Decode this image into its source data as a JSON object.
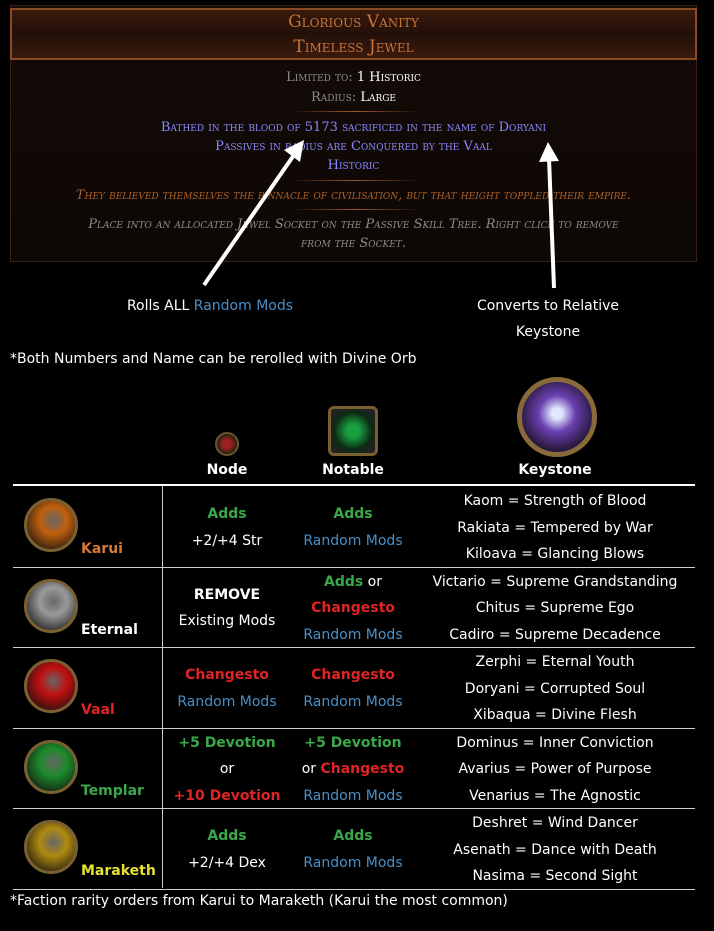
{
  "jewel": {
    "name": "Glorious Vanity",
    "base": "Timeless Jewel",
    "limited_label": "Limited to:",
    "limited_value": "1 Historic",
    "radius_label": "Radius:",
    "radius_value": "Large",
    "mods": [
      "Bathed in the blood of 5173 sacrificed in the name of Doryani",
      "Passives in radius are Conquered by the Vaal",
      "Historic"
    ],
    "flavor": "They believed themselves the pinnacle of civilisation, but that height toppled their empire.",
    "help": [
      "Place into an allocated Jewel Socket on the Passive Skill Tree. Right click to remove",
      "from the Socket."
    ]
  },
  "annotations": {
    "left_prefix": "Rolls ALL ",
    "left_highlight": "Random Mods",
    "right_line1": "Converts to Relative",
    "right_line2": "Keystone",
    "reroll_note": "*Both Numbers and Name can be rerolled with Divine Orb"
  },
  "columns": {
    "node": "Node",
    "notable": "Notable",
    "keystone": "Keystone"
  },
  "rows": [
    {
      "faction": "Karui",
      "faction_color": "#d27a3a",
      "orb_color": "#c0600e",
      "node": [
        [
          {
            "t": "Adds",
            "c": "green"
          }
        ],
        [
          {
            "t": "+2/+4 Str",
            "c": "white"
          }
        ]
      ],
      "notable": [
        [
          {
            "t": "Adds",
            "c": "green"
          }
        ],
        [
          {
            "t": "Random Mods",
            "c": "blue"
          }
        ]
      ],
      "keystones": [
        "Kaom = Strength of Blood",
        "Rakiata = Tempered by War",
        "Kiloava = Glancing Blows"
      ]
    },
    {
      "faction": "Eternal",
      "faction_color": "#ffffff",
      "orb_color": "#9a9a9a",
      "node": [
        [
          {
            "t": "REMOVE",
            "c": "whiteb"
          }
        ],
        [
          {
            "t": "Existing Mods",
            "c": "white"
          }
        ]
      ],
      "notable": [
        [
          {
            "t": "Adds",
            "c": "green"
          },
          {
            "t": " or",
            "c": "white"
          }
        ],
        [
          {
            "t": "Changesto",
            "c": "red"
          }
        ],
        [
          {
            "t": "Random Mods",
            "c": "blue"
          }
        ]
      ],
      "keystones": [
        "Victario = Supreme Grandstanding",
        "Chitus = Supreme Ego",
        "Cadiro = Supreme Decadence"
      ]
    },
    {
      "faction": "Vaal",
      "faction_color": "#e02424",
      "orb_color": "#c01010",
      "node": [
        [
          {
            "t": "Changesto",
            "c": "red"
          }
        ],
        [
          {
            "t": "Random Mods",
            "c": "blue"
          }
        ]
      ],
      "notable": [
        [
          {
            "t": "Changesto",
            "c": "red"
          }
        ],
        [
          {
            "t": "Random Mods",
            "c": "blue"
          }
        ]
      ],
      "keystones": [
        "Zerphi = Eternal Youth",
        "Doryani = Corrupted Soul",
        "Xibaqua = Divine Flesh"
      ]
    },
    {
      "faction": "Templar",
      "faction_color": "#3aa84a",
      "orb_color": "#1d8a2a",
      "node": [
        [
          {
            "t": "+5 Devotion",
            "c": "green"
          }
        ],
        [
          {
            "t": "or",
            "c": "white"
          }
        ],
        [
          {
            "t": "+10 Devotion",
            "c": "red"
          }
        ]
      ],
      "notable": [
        [
          {
            "t": "+5 Devotion",
            "c": "green"
          }
        ],
        [
          {
            "t": "or ",
            "c": "white"
          },
          {
            "t": "Changesto",
            "c": "red"
          }
        ],
        [
          {
            "t": "Random Mods",
            "c": "blue"
          }
        ]
      ],
      "keystones": [
        "Dominus = Inner Conviction",
        "Avarius = Power of Purpose",
        "Venarius = The Agnostic"
      ]
    },
    {
      "faction": "Maraketh",
      "faction_color": "#e6e030",
      "orb_color": "#b08a10",
      "node": [
        [
          {
            "t": "Adds",
            "c": "green"
          }
        ],
        [
          {
            "t": "+2/+4 Dex",
            "c": "white"
          }
        ]
      ],
      "notable": [
        [
          {
            "t": "Adds",
            "c": "green"
          }
        ],
        [
          {
            "t": "Random Mods",
            "c": "blue"
          }
        ]
      ],
      "keystones": [
        "Deshret = Wind Dancer",
        "Asenath = Dance with Death",
        "Nasima = Second Sight"
      ]
    }
  ],
  "footer_note": "*Faction rarity orders from Karui to Maraketh (Karui the most common)"
}
